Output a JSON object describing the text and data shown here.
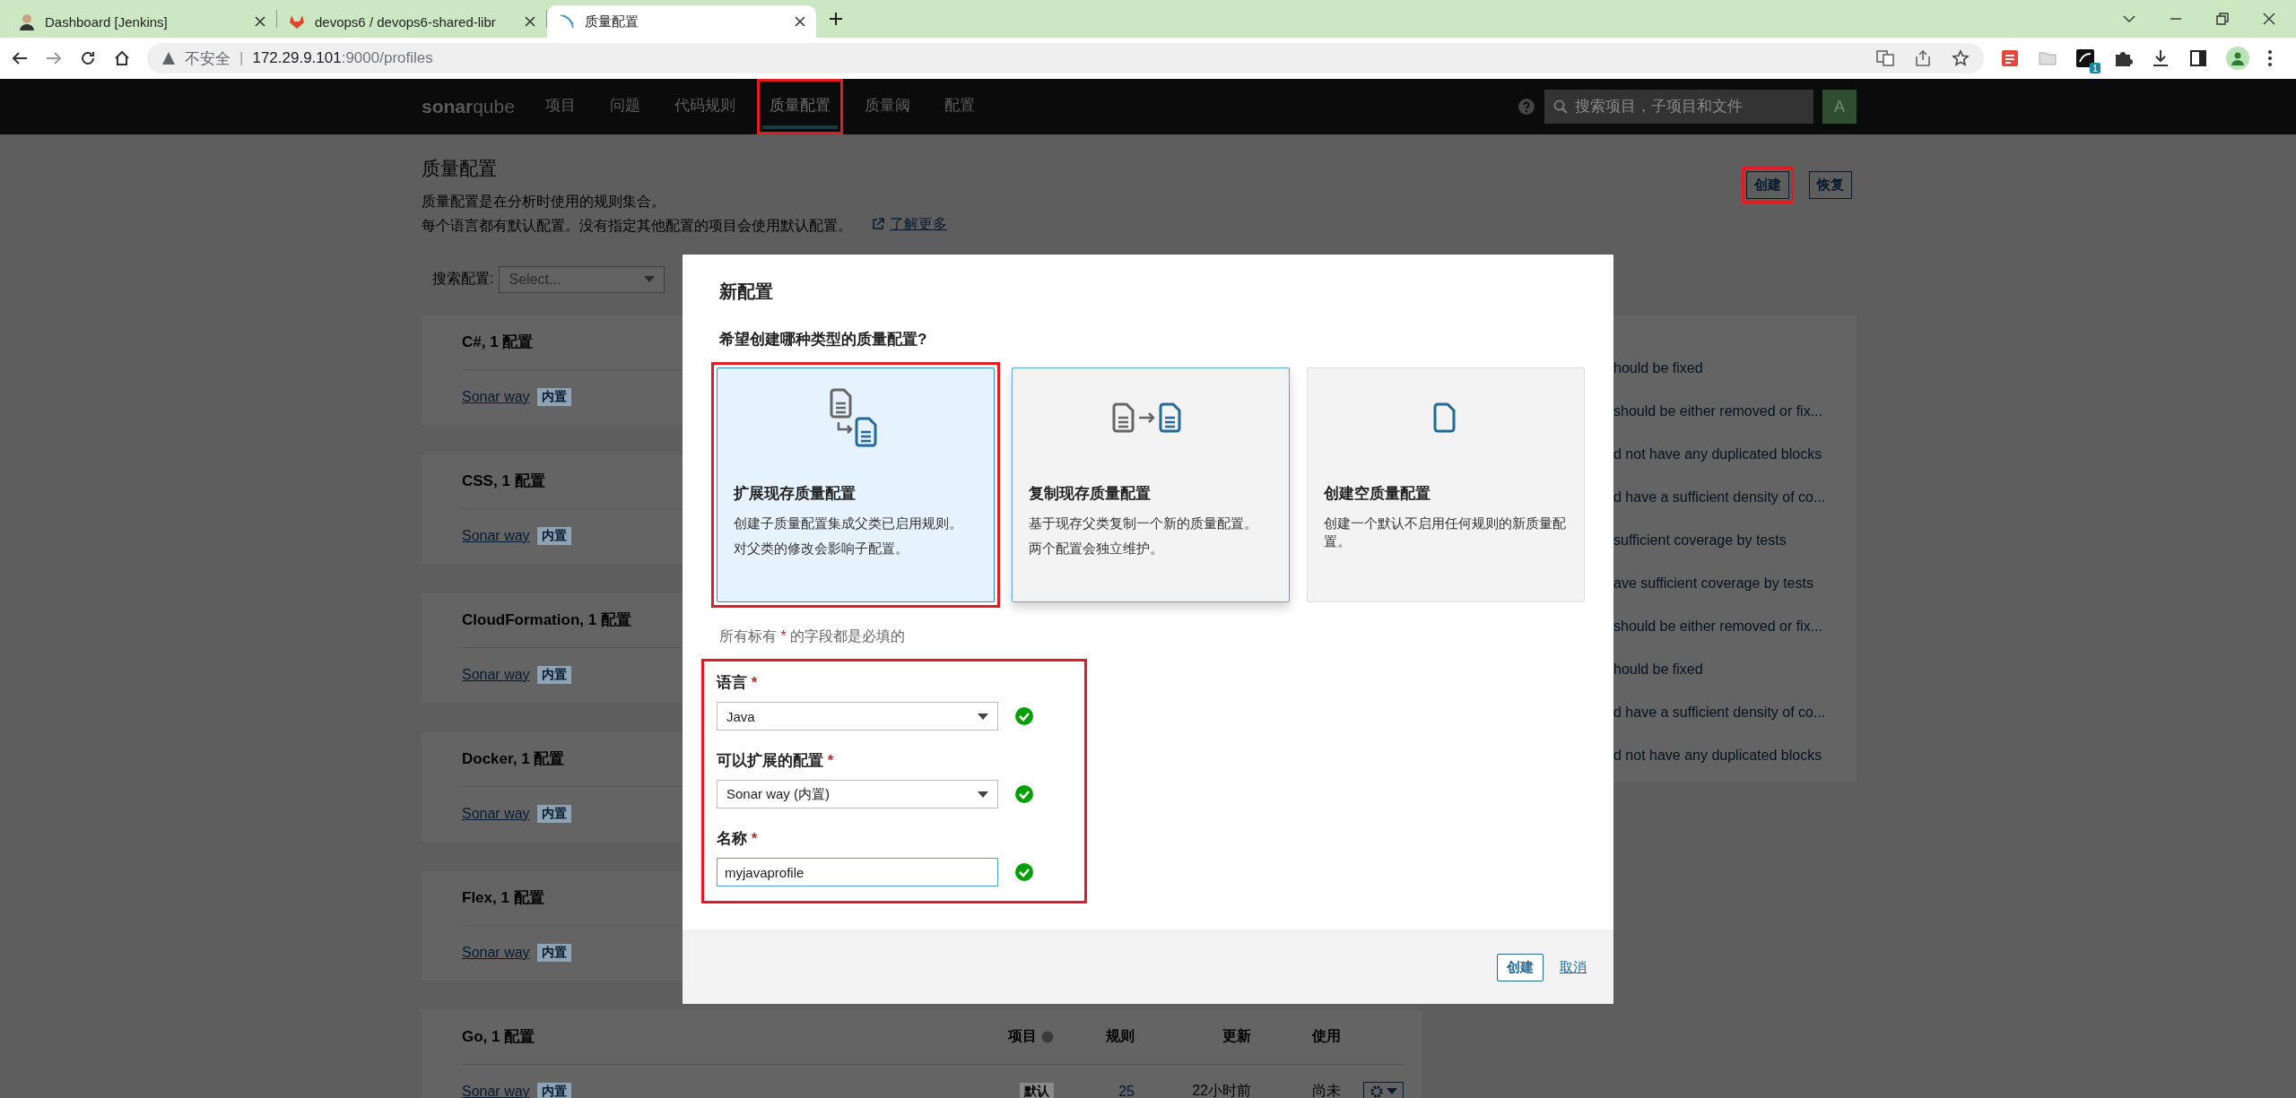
{
  "browser": {
    "tabs": [
      {
        "title": "Dashboard [Jenkins]",
        "selected": false
      },
      {
        "title": "devops6 / devops6-shared-libr",
        "selected": false
      },
      {
        "title": "质量配置",
        "selected": true
      }
    ],
    "security": "不安全",
    "separator": "|",
    "url_host": "172.29.9.101",
    "url_rest": ":9000/profiles",
    "extension_badge": "1"
  },
  "nav": {
    "logo": "**sonar**qube",
    "items": [
      {
        "label": "项目",
        "selected": false,
        "highlighted": false
      },
      {
        "label": "问题",
        "selected": false,
        "highlighted": false
      },
      {
        "label": "代码规则",
        "selected": false,
        "highlighted": false
      },
      {
        "label": "质量配置",
        "selected": true,
        "highlighted": true
      },
      {
        "label": "质量阈",
        "selected": false,
        "highlighted": false
      },
      {
        "label": "配置",
        "selected": false,
        "highlighted": false
      }
    ],
    "search_placeholder": "搜索项目，子项目和文件",
    "avatar": "A"
  },
  "page": {
    "title": "质量配置",
    "description": [
      "质量配置是在分析时使用的规则集合。",
      "每个语言都有默认配置。没有指定其他配置的项目会使用默认配置。"
    ],
    "learn_more": "了解更多",
    "buttons": [
      {
        "label": "创建",
        "highlighted": true
      },
      {
        "label": "恢复",
        "highlighted": false
      }
    ],
    "search": {
      "label": "搜索配置:",
      "placeholder": "Select..."
    }
  },
  "languages": [
    {
      "title": "C#, 1 配置",
      "profiles": [
        {
          "name": "Sonar way",
          "tag": "内置"
        }
      ]
    },
    {
      "title": "CSS, 1 配置",
      "profiles": [
        {
          "name": "Sonar way",
          "tag": "内置"
        }
      ]
    },
    {
      "title": "CloudFormation, 1 配置",
      "profiles": [
        {
          "name": "Sonar way",
          "tag": "内置"
        }
      ]
    },
    {
      "title": "Docker, 1 配置",
      "profiles": [
        {
          "name": "Sonar way",
          "tag": "内置"
        }
      ]
    },
    {
      "title": "Flex, 1 配置",
      "profiles": [
        {
          "name": "Sonar way",
          "tag": "内置"
        }
      ]
    },
    {
      "title": "Go, 1 配置",
      "columns": [
        "项目",
        "规则",
        "更新",
        "使用"
      ],
      "profiles": [
        {
          "name": "Sonar way",
          "tag": "内置",
          "default_tag": "默认",
          "rules": "25",
          "updated": "22小时前",
          "used": "尚未"
        }
      ]
    }
  ],
  "side_list": [
    "hould be fixed",
    "should be either removed or fix...",
    "d not have any duplicated blocks",
    "d have a sufficient density of co...",
    "sufficient coverage by tests",
    "ave sufficient coverage by tests",
    "should be either removed or fix...",
    "hould be fixed",
    "d have a sufficient density of co...",
    "d not have any duplicated blocks"
  ],
  "modal": {
    "title": "新配置",
    "question": "希望创建哪种类型的质量配置?",
    "options": [
      {
        "kind": "extend",
        "title": "扩展现存质量配置",
        "lines": [
          "创建子质量配置集成父类已启用规则。",
          "对父类的修改会影响子配置。"
        ],
        "selected": true,
        "hovered": false,
        "highlighted": true
      },
      {
        "kind": "copy",
        "title": "复制现存质量配置",
        "lines": [
          "基于现存父类复制一个新的质量配置。",
          "两个配置会独立维护。"
        ],
        "selected": false,
        "hovered": true,
        "highlighted": false
      },
      {
        "kind": "blank",
        "title": "创建空质量配置",
        "lines": [
          "创建一个默认不启用任何规则的新质量配置。"
        ],
        "selected": false,
        "hovered": false,
        "highlighted": false
      }
    ],
    "required_note": {
      "before": "所有标有",
      "mark": "*",
      "after": "的字段都是必填的"
    },
    "fields_highlighted": true,
    "fields": [
      {
        "kind": "select",
        "label": "语言",
        "required": true,
        "value": "Java",
        "valid": true
      },
      {
        "kind": "select",
        "label": "可以扩展的配置",
        "required": true,
        "value": "Sonar way (内置)",
        "valid": true
      },
      {
        "kind": "input",
        "label": "名称",
        "required": true,
        "value": "myjavaprofile",
        "valid": true
      }
    ],
    "submit": "创建",
    "cancel": "取消"
  }
}
